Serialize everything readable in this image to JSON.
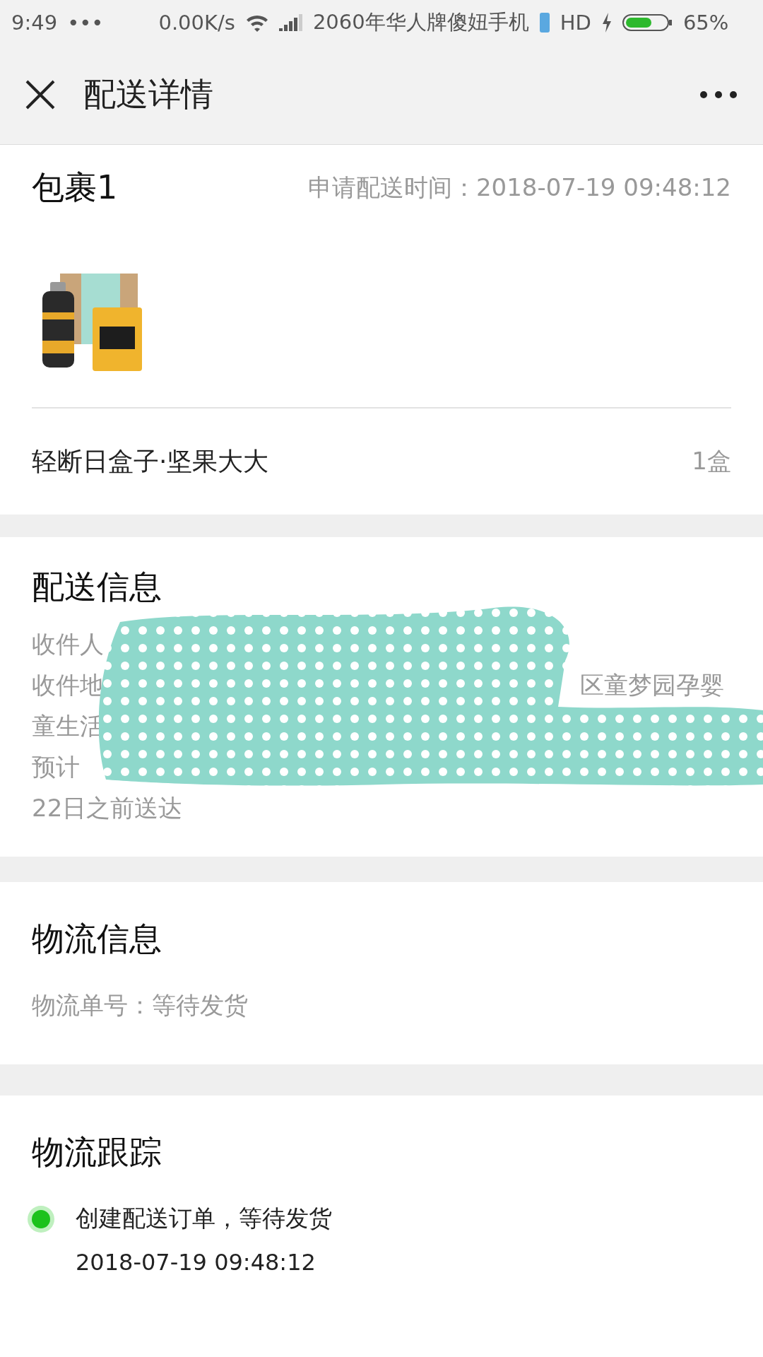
{
  "status_bar": {
    "time": "9:49",
    "dots": "•••",
    "speed": "0.00K/s",
    "carrier": "2060年华人牌傻妞手机",
    "network": "HD",
    "battery": "65%"
  },
  "header": {
    "title": "配送详情"
  },
  "package": {
    "title": "包裹1",
    "request_time": "申请配送时间：2018-07-19 09:48:12",
    "item": {
      "name": "轻断日盒子·坚果大大",
      "quantity": "1盒"
    }
  },
  "delivery": {
    "title": "配送信息",
    "lines": [
      {
        "left": "收件人"
      },
      {
        "left": "收件地",
        "right": "区童梦园孕婴"
      },
      {
        "left": "童生活"
      },
      {
        "left": "预计"
      },
      {
        "left": "22日之前送达"
      }
    ],
    "redacted": true
  },
  "logistics": {
    "title": "物流信息",
    "tracking_number": "物流单号：等待发货"
  },
  "tracking": {
    "title": "物流跟踪",
    "events": [
      {
        "text": "创建配送订单，等待发货",
        "time": "2018-07-19 09:48:12",
        "current": true
      }
    ]
  }
}
